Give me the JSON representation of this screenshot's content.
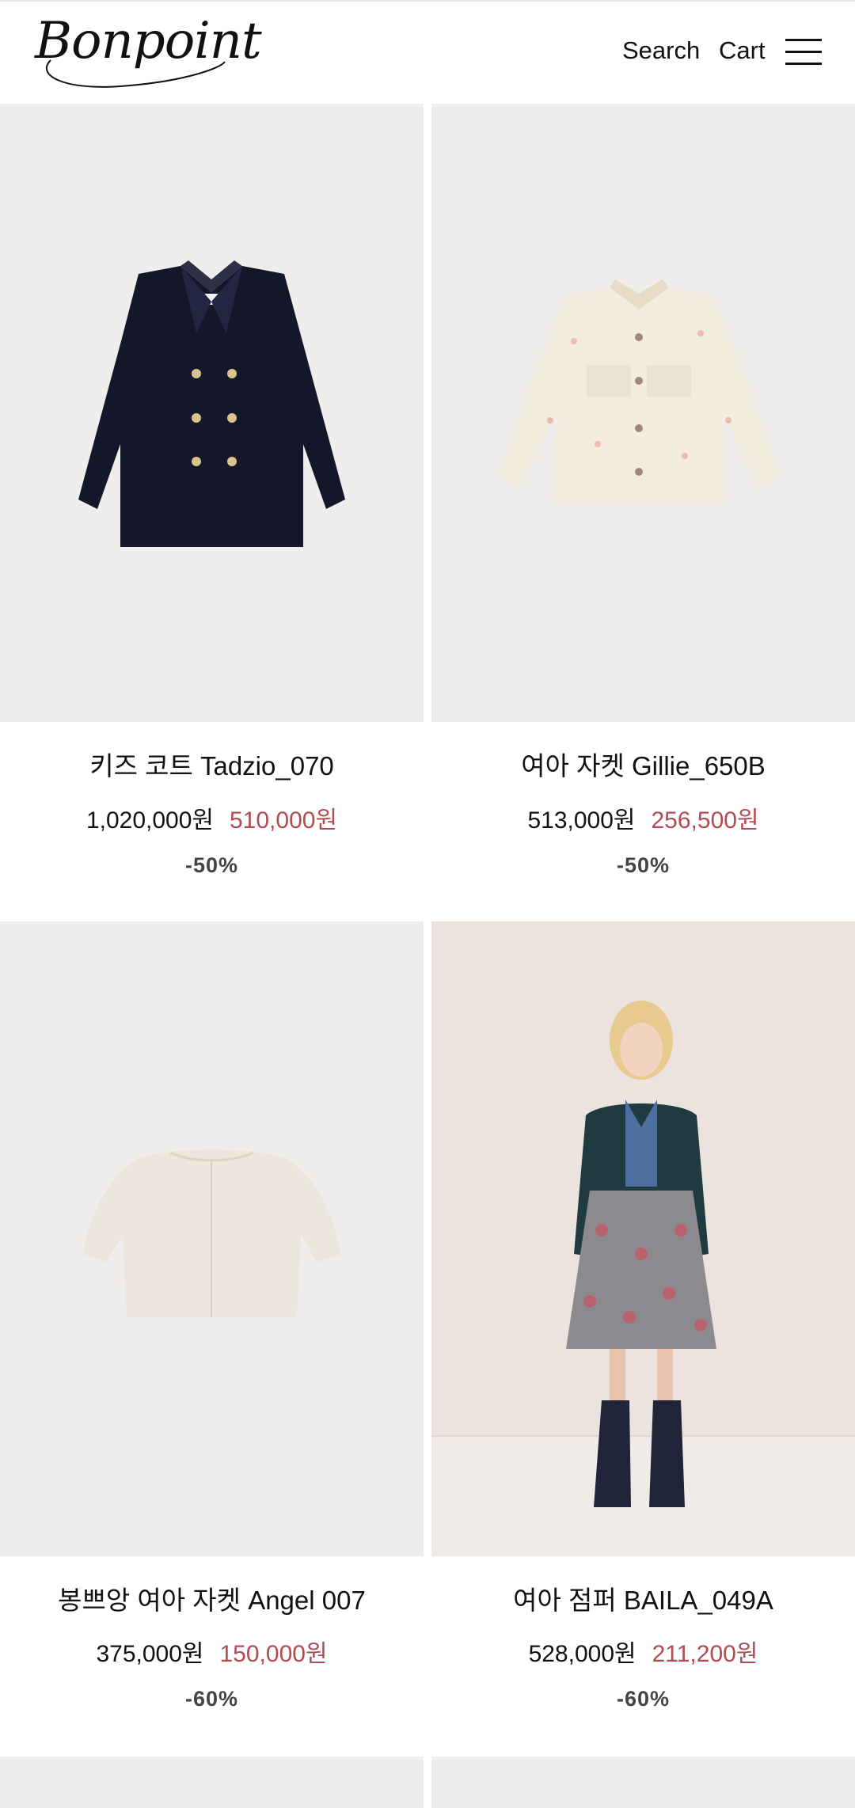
{
  "header": {
    "logo_text": "Bonpoint",
    "search_label": "Search",
    "cart_label": "Cart",
    "menu_icon": "hamburger-icon"
  },
  "products": [
    {
      "name": "키즈 코트 Tadzio_070",
      "original_price": "1,020,000원",
      "sale_price": "510,000원",
      "discount": "-50%",
      "image": "navy double-breasted wool coat"
    },
    {
      "name": "여아 자켓 Gillie_650B",
      "original_price": "513,000원",
      "sale_price": "256,500원",
      "discount": "-50%",
      "image": "cream cherry-print denim jacket"
    },
    {
      "name": "봉쁘앙 여아 자켓 Angel 007",
      "original_price": "375,000원",
      "sale_price": "150,000원",
      "discount": "-60%",
      "image": "ivory shearling cropped jacket"
    },
    {
      "name": "여아 점퍼 BAILA_049A",
      "original_price": "528,000원",
      "sale_price": "211,200원",
      "discount": "-60%",
      "image": "child wearing dark green quilted jumper"
    }
  ],
  "colors": {
    "sale_price": "#b34a52",
    "image_bg": "#efeeec",
    "text": "#111111"
  }
}
